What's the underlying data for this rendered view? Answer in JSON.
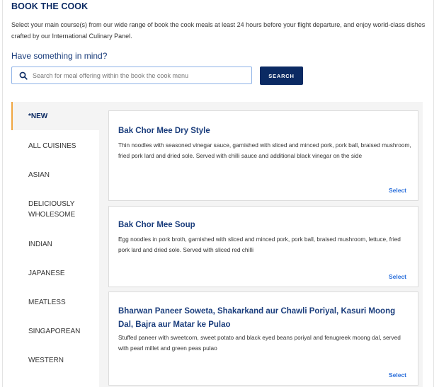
{
  "header": {
    "title": "BOOK THE COOK",
    "intro": "Select your main course(s) from our wide range of book the cook meals at least 24 hours before your flight departure, and enjoy world-class dishes crafted by our International Culinary Panel.",
    "prompt": "Have something in mind?"
  },
  "search": {
    "icon": "search-icon",
    "placeholder": "Search for meal offering within the book the cook menu",
    "value": "",
    "button_label": "SEARCH"
  },
  "colors": {
    "brand_navy": "#0b2a63",
    "active_accent": "#f0a640",
    "link_blue": "#2a6fdb",
    "panel_gray": "#f4f4f4"
  },
  "sidebar": {
    "active_index": 0,
    "items": [
      {
        "label": "*NEW"
      },
      {
        "label": "ALL CUISINES"
      },
      {
        "label": "ASIAN"
      },
      {
        "label": "DELICIOUSLY WHOLESOME"
      },
      {
        "label": "INDIAN"
      },
      {
        "label": "JAPANESE"
      },
      {
        "label": "MEATLESS"
      },
      {
        "label": "SINGAPOREAN"
      },
      {
        "label": "WESTERN"
      }
    ]
  },
  "meals": [
    {
      "name": "Bak Chor Mee Dry Style",
      "description": "Thin noodles with seasoned vinegar sauce, garnished with sliced and minced pork, pork ball, braised mushroom, fried pork lard and dried sole. Served with chilli sauce and additional black vinegar on the side",
      "action": "Select"
    },
    {
      "name": "Bak Chor Mee Soup",
      "description": "Egg noodles in pork broth, garnished with sliced and minced pork, pork ball, braised mushroom, lettuce, fried pork lard and dried sole. Served with sliced red chilli",
      "action": "Select"
    },
    {
      "name": "Bharwan Paneer Soweta, Shakarkand aur Chawli Poriyal, Kasuri Moong Dal, Bajra aur Matar ke Pulao",
      "description": "Stuffed paneer with sweetcorn, sweet potato and black eyed beans poriyal and fenugreek moong dal, served with pearl millet and green peas pulao",
      "action": "Select"
    }
  ]
}
